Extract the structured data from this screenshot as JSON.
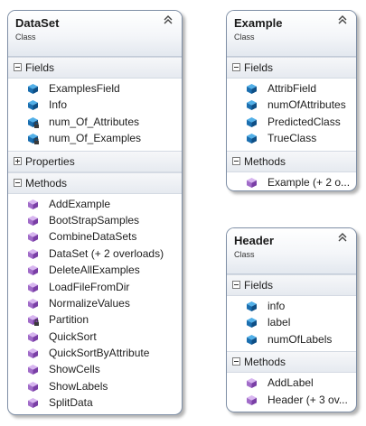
{
  "classes": [
    {
      "name": "DataSet",
      "kind": "Class",
      "sections": [
        {
          "label": "Fields",
          "expanded": true,
          "members": [
            {
              "name": "ExamplesField",
              "icon": "field-icon"
            },
            {
              "name": "Info",
              "icon": "field-icon"
            },
            {
              "name": "num_Of_Attributes",
              "icon": "private-field-icon"
            },
            {
              "name": "num_Of_Examples",
              "icon": "private-field-icon"
            }
          ]
        },
        {
          "label": "Properties",
          "expanded": false,
          "members": []
        },
        {
          "label": "Methods",
          "expanded": true,
          "members": [
            {
              "name": "AddExample",
              "icon": "method-icon"
            },
            {
              "name": "BootStrapSamples",
              "icon": "method-icon"
            },
            {
              "name": "CombineDataSets",
              "icon": "method-icon"
            },
            {
              "name": "DataSet (+ 2 overloads)",
              "icon": "method-icon"
            },
            {
              "name": "DeleteAllExamples",
              "icon": "method-icon"
            },
            {
              "name": "LoadFileFromDir",
              "icon": "method-icon"
            },
            {
              "name": "NormalizeValues",
              "icon": "method-icon"
            },
            {
              "name": "Partition",
              "icon": "private-method-icon"
            },
            {
              "name": "QuickSort",
              "icon": "method-icon"
            },
            {
              "name": "QuickSortByAttribute",
              "icon": "method-icon"
            },
            {
              "name": "ShowCells",
              "icon": "method-icon"
            },
            {
              "name": "ShowLabels",
              "icon": "method-icon"
            },
            {
              "name": "SplitData",
              "icon": "method-icon"
            }
          ]
        }
      ]
    },
    {
      "name": "Example",
      "kind": "Class",
      "sections": [
        {
          "label": "Fields",
          "expanded": true,
          "members": [
            {
              "name": "AttribField",
              "icon": "field-icon"
            },
            {
              "name": "numOfAttributes",
              "icon": "field-icon"
            },
            {
              "name": "PredictedClass",
              "icon": "field-icon"
            },
            {
              "name": "TrueClass",
              "icon": "field-icon"
            }
          ]
        },
        {
          "label": "Methods",
          "expanded": true,
          "members": [
            {
              "name": "Example (+ 2 o...",
              "icon": "method-icon"
            }
          ]
        }
      ]
    },
    {
      "name": "Header",
      "kind": "Class",
      "sections": [
        {
          "label": "Fields",
          "expanded": true,
          "members": [
            {
              "name": "info",
              "icon": "field-icon"
            },
            {
              "name": "label",
              "icon": "field-icon"
            },
            {
              "name": "numOfLabels",
              "icon": "field-icon"
            }
          ]
        },
        {
          "label": "Methods",
          "expanded": true,
          "members": [
            {
              "name": "AddLabel",
              "icon": "method-icon"
            },
            {
              "name": "Header (+ 3 ov...",
              "icon": "method-icon"
            }
          ]
        }
      ]
    }
  ]
}
